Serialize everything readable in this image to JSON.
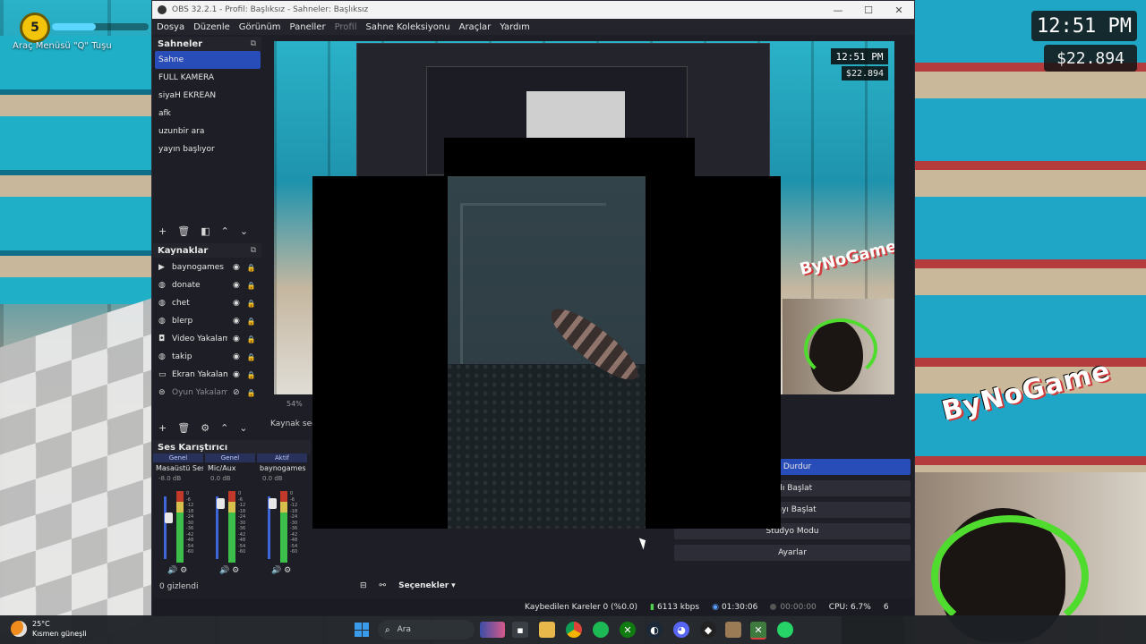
{
  "game_hud": {
    "level": "5",
    "menu_hint": "Araç Menüsü \"Q\" Tuşu",
    "clock": "12:51 PM",
    "money": "$22.894",
    "brand": "ByNoGame"
  },
  "obs": {
    "window_title": "OBS 32.2.1 - Profil: Başlıksız - Sahneler: Başlıksız",
    "menu": [
      "Dosya",
      "Düzenle",
      "Görünüm",
      "Paneller",
      "Profil",
      "Sahne Koleksiyonu",
      "Araçlar",
      "Yardım"
    ],
    "scenes": {
      "header": "Sahneler",
      "items": [
        "Sahne",
        "FULL KAMERA",
        "siyaH EKREAN",
        "afk",
        "uzunbir ara",
        "yayın başlıyor"
      ]
    },
    "sources": {
      "header": "Kaynaklar",
      "items": [
        "baynogames",
        "donate",
        "chet",
        "blerp",
        "Video Yakalama",
        "takip",
        "Ekran Yakalama",
        "Oyun Yakalama"
      ]
    },
    "preview": {
      "zoom": "54%",
      "source_status": "Kaynak seçi"
    },
    "mixer": {
      "header": "Ses Karıştırıcı",
      "channels": [
        {
          "tag": "Genel",
          "name": "Masaüstü Ses",
          "db": "-8.0 dB"
        },
        {
          "tag": "Genel",
          "name": "Mic/Aux",
          "db": "0.0 dB"
        },
        {
          "tag": "Aktif",
          "name": "baynogames",
          "db": "0.0 dB"
        }
      ],
      "scale": [
        "0",
        "-6",
        "-12",
        "-18",
        "-24",
        "-30",
        "-36",
        "-42",
        "-48",
        "-54",
        "-60"
      ]
    },
    "hidden_count": "0 gizlendi",
    "options_label": "Seçenekler",
    "controls": [
      "nı Durdur",
      "ydı Başlat",
      "erayı Başlat",
      "Stüdyo Modu",
      "Ayarlar"
    ],
    "status": {
      "dropped": "Kaybedilen Kareler 0 (%0.0)",
      "bitrate": "6113 kbps",
      "stream_time": "01:30:06",
      "rec_time": "00:00:00",
      "cpu": "CPU: 6.7%",
      "extra": "6"
    }
  },
  "taskbar": {
    "temperature": "25°C",
    "weather": "Kısmen güneşli",
    "search_placeholder": "Ara"
  }
}
